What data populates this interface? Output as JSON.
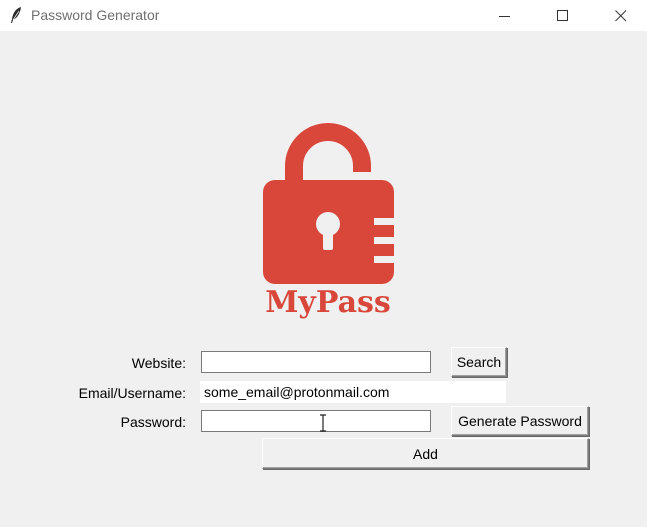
{
  "window": {
    "title": "Password Generator"
  },
  "logo": {
    "text": "MyPass",
    "color": "#d9473b"
  },
  "form": {
    "website_label": "Website:",
    "website_value": "",
    "search_label": "Search",
    "email_label": "Email/Username:",
    "email_value": "some_email@protonmail.com",
    "password_label": "Password:",
    "password_value": "",
    "generate_label": "Generate Password",
    "add_label": "Add"
  },
  "icons": {
    "app": "feather-icon",
    "minimize": "minimize-icon",
    "maximize": "maximize-icon",
    "close": "close-icon",
    "cursor": "text-cursor-icon"
  }
}
